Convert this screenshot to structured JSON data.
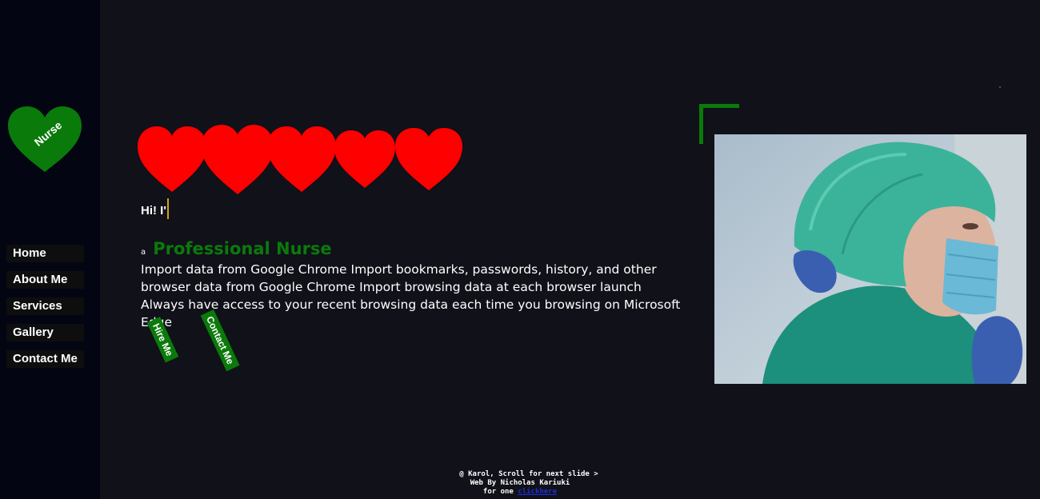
{
  "sidebar": {
    "logo_text": "Nurse",
    "nav": [
      {
        "label": "Home"
      },
      {
        "label": "About Me"
      },
      {
        "label": "Services"
      },
      {
        "label": "Gallery"
      },
      {
        "label": "Contact Me"
      }
    ]
  },
  "hero": {
    "greeting": "Hi! I'",
    "role_prefix": "a",
    "role_title": "Professional Nurse",
    "description": "Import data from Google Chrome Import bookmarks, passwords, history, and other browser data from Google Chrome Import browsing data at each browser launch Always have access to your recent browsing data each time you browsing on Microsoft Edge",
    "hire_button": "Hire Me",
    "contact_button": "Contact Me"
  },
  "footer": {
    "line1": "@ Karol, Scroll for next slide >",
    "line2": "Web By Nicholas Kariuki",
    "line3_prefix": "for one",
    "link1": "click",
    "link2": "here"
  },
  "colors": {
    "accent": "#0a7a0a",
    "hearts": "#ff0000",
    "background": "#101119",
    "sidebar": "#030612"
  }
}
